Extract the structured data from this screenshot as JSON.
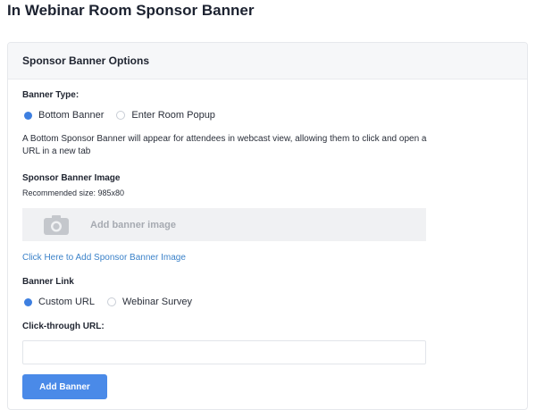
{
  "page": {
    "title": "In Webinar Room Sponsor Banner"
  },
  "panel": {
    "header": "Sponsor Banner Options",
    "banner_type": {
      "label": "Banner Type:",
      "options": [
        "Bottom Banner",
        "Enter Room Popup"
      ],
      "selected": "Bottom Banner",
      "description": "A Bottom Sponsor Banner will appear for attendees in webcast view, allowing them to click and open a URL in a new tab"
    },
    "image": {
      "label": "Sponsor Banner Image",
      "recommended": "Recommended size: 985x80",
      "placeholder": "Add banner image",
      "icon": "camera-icon",
      "link": "Click Here to Add Sponsor Banner Image"
    },
    "banner_link": {
      "label": "Banner Link",
      "options": [
        "Custom URL",
        "Webinar Survey"
      ],
      "selected": "Custom URL"
    },
    "url": {
      "label": "Click-through URL:",
      "value": "",
      "placeholder": ""
    },
    "submit_label": "Add Banner"
  },
  "colors": {
    "accent": "#3d7fe0",
    "button": "#4a8ae8",
    "link": "#3b82c9"
  }
}
